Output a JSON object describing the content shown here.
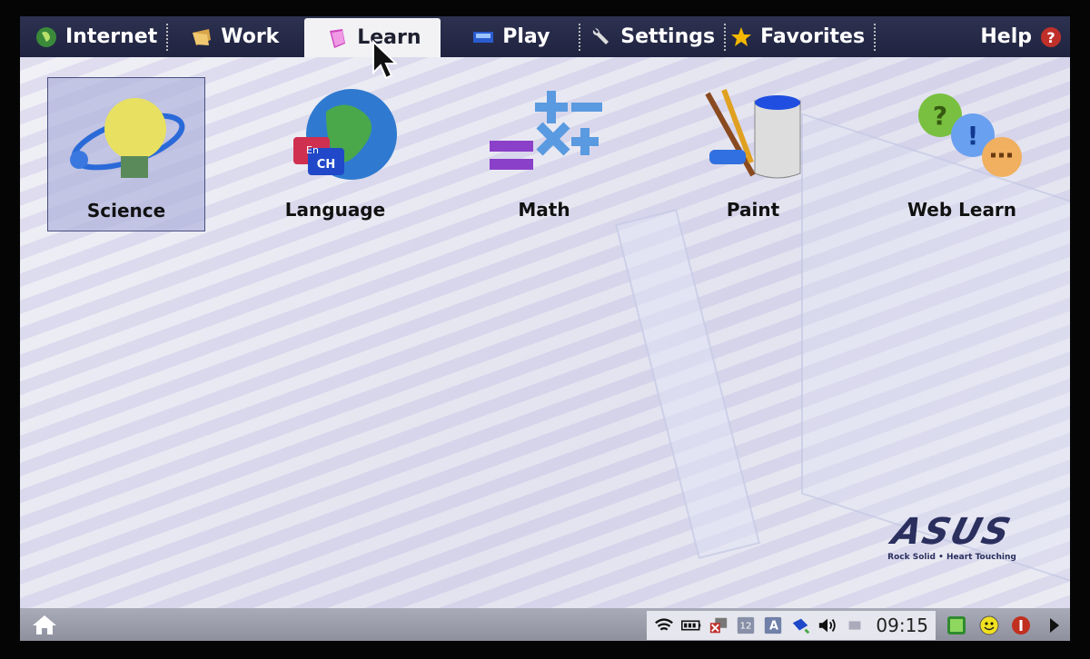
{
  "tabs": [
    {
      "label": "Internet",
      "icon": "globe-icon",
      "active": false
    },
    {
      "label": "Work",
      "icon": "folder-icon",
      "active": false
    },
    {
      "label": "Learn",
      "icon": "book-icon",
      "active": true
    },
    {
      "label": "Play",
      "icon": "game-icon",
      "active": false
    },
    {
      "label": "Settings",
      "icon": "wrench-icon",
      "active": false
    },
    {
      "label": "Favorites",
      "icon": "star-icon",
      "active": false
    }
  ],
  "help": {
    "label": "Help",
    "icon": "question-icon"
  },
  "apps": [
    {
      "label": "Science",
      "icon": "lightbulb-atom-icon",
      "selected": true
    },
    {
      "label": "Language",
      "icon": "globe-language-icon",
      "selected": false
    },
    {
      "label": "Math",
      "icon": "math-symbols-icon",
      "selected": false
    },
    {
      "label": "Paint",
      "icon": "paint-bucket-icon",
      "selected": false
    },
    {
      "label": "Web Learn",
      "icon": "web-learn-icon",
      "selected": false
    }
  ],
  "brand": {
    "logo": "ASUS",
    "tagline": "Rock Solid • Heart Touching"
  },
  "taskbar": {
    "clock": "09:15",
    "colors": {
      "accent": "#262b45"
    }
  },
  "language_badges": {
    "en": "En",
    "ch": "CH"
  }
}
